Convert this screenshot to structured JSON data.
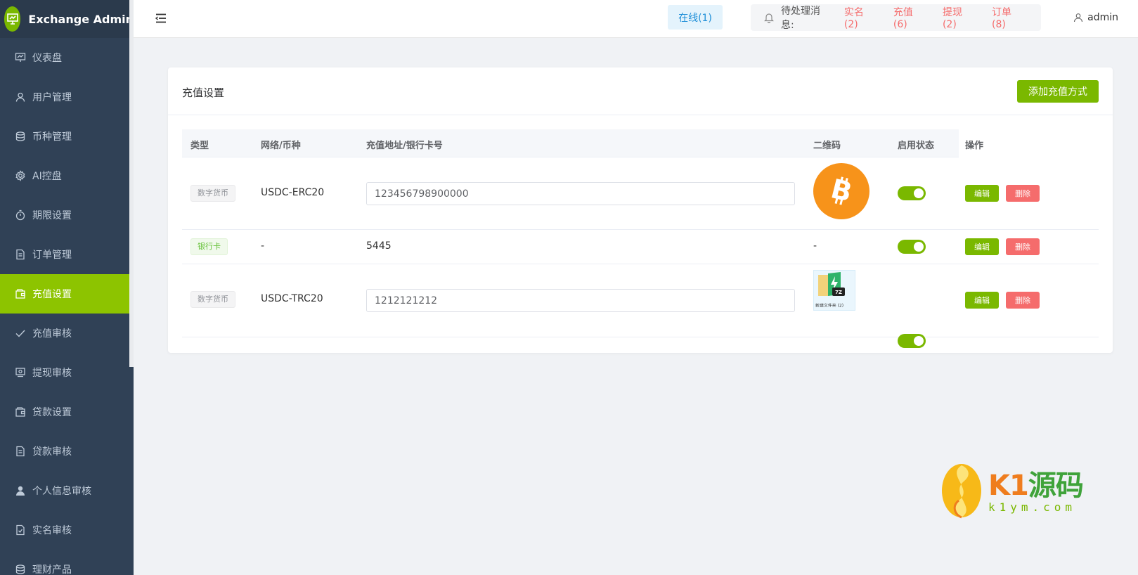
{
  "app": {
    "title": "Exchange Admin"
  },
  "sidebar": {
    "items": [
      {
        "label": "仪表盘",
        "icon": "chart-board-icon",
        "active": false
      },
      {
        "label": "用户管理",
        "icon": "user-icon",
        "active": false
      },
      {
        "label": "币种管理",
        "icon": "coins-icon",
        "active": false
      },
      {
        "label": "AI控盘",
        "icon": "gear-icon",
        "active": false
      },
      {
        "label": "期限设置",
        "icon": "timer-icon",
        "active": false
      },
      {
        "label": "订单管理",
        "icon": "document-icon",
        "active": false
      },
      {
        "label": "充值设置",
        "icon": "wallet-icon",
        "active": true
      },
      {
        "label": "充值审核",
        "icon": "check-icon",
        "active": false
      },
      {
        "label": "提现审核",
        "icon": "cash-icon",
        "active": false
      },
      {
        "label": "贷款设置",
        "icon": "wallet-icon",
        "active": false
      },
      {
        "label": "贷款审核",
        "icon": "document-icon",
        "active": false
      },
      {
        "label": "个人信息审核",
        "icon": "person-filled-icon",
        "active": false
      },
      {
        "label": "实名审核",
        "icon": "document-check-icon",
        "active": false
      },
      {
        "label": "理财产品",
        "icon": "coins-icon",
        "active": false
      }
    ]
  },
  "header": {
    "online": "在线(1)",
    "notice_label": "待处理消息:",
    "notices": [
      "实名(2)",
      "充值(6)",
      "提现(2)",
      "订单(8)"
    ],
    "user": "admin"
  },
  "card": {
    "title": "充值设置",
    "add_button": "添加充值方式",
    "columns": [
      "类型",
      "网络/币种",
      "充值地址/银行卡号",
      "二维码",
      "启用状态",
      "操作"
    ],
    "rows": [
      {
        "type": "数字货币",
        "network": "USDC-ERC20",
        "address": "123456798900000",
        "qr": "bitcoin-logo",
        "enabled": true
      },
      {
        "type": "银行卡",
        "network": "-",
        "address": "5445",
        "qr": "-",
        "enabled": true
      },
      {
        "type": "数字货币",
        "network": "USDC-TRC20",
        "address": "1212121212",
        "qr": "folder-thumbnail",
        "enabled": true
      }
    ],
    "edit_label": "编辑",
    "delete_label": "删除",
    "folder_caption": "新建文件夹 (2)"
  },
  "watermark": {
    "brand_k": "K1",
    "brand_cn": "源码",
    "domain": "k1ym.com"
  },
  "colors": {
    "accent": "#7ab800",
    "sidebar": "#304156",
    "danger": "#f56c6c",
    "link": "#1f8fd8"
  }
}
